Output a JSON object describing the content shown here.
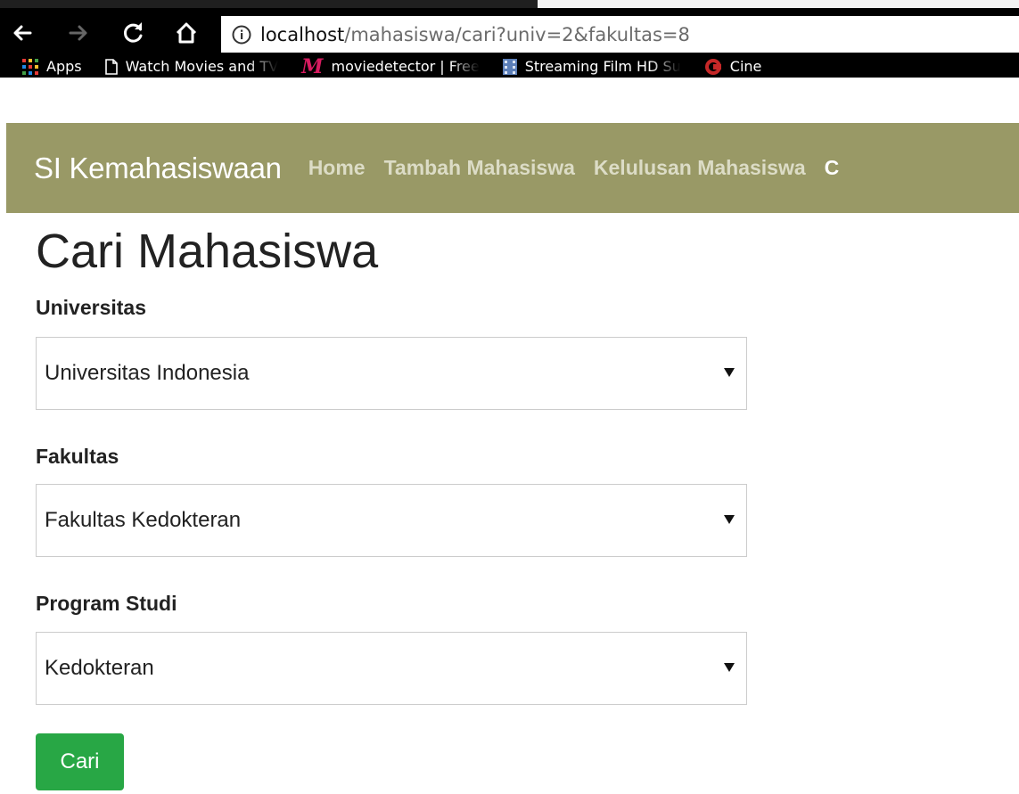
{
  "browser": {
    "url_host": "localhost",
    "url_path": "/mahasiswa/cari?univ=2&fakultas=8",
    "bookmarks": [
      {
        "label": "Apps",
        "icon": "apps-grid-icon"
      },
      {
        "label": "Watch Movies and TV",
        "icon": "page-icon"
      },
      {
        "label": "moviedetector | Free",
        "icon": "moviedetector-logo-icon"
      },
      {
        "label": "Streaming Film HD Su",
        "icon": "film-strip-icon"
      },
      {
        "label": "Cine",
        "icon": "cinema-logo-icon"
      }
    ]
  },
  "navbar": {
    "brand": "SI Kemahasiswaan",
    "links": [
      "Home",
      "Tambah Mahasiswa",
      "Kelulusan Mahasiswa",
      "C"
    ],
    "bg_color": "#999966"
  },
  "form": {
    "title": "Cari Mahasiswa",
    "fields": [
      {
        "label": "Universitas",
        "value": "Universitas Indonesia"
      },
      {
        "label": "Fakultas",
        "value": "Fakultas Kedokteran"
      },
      {
        "label": "Program Studi",
        "value": "Kedokteran"
      }
    ],
    "submit_label": "Cari",
    "submit_color": "#28a745"
  }
}
